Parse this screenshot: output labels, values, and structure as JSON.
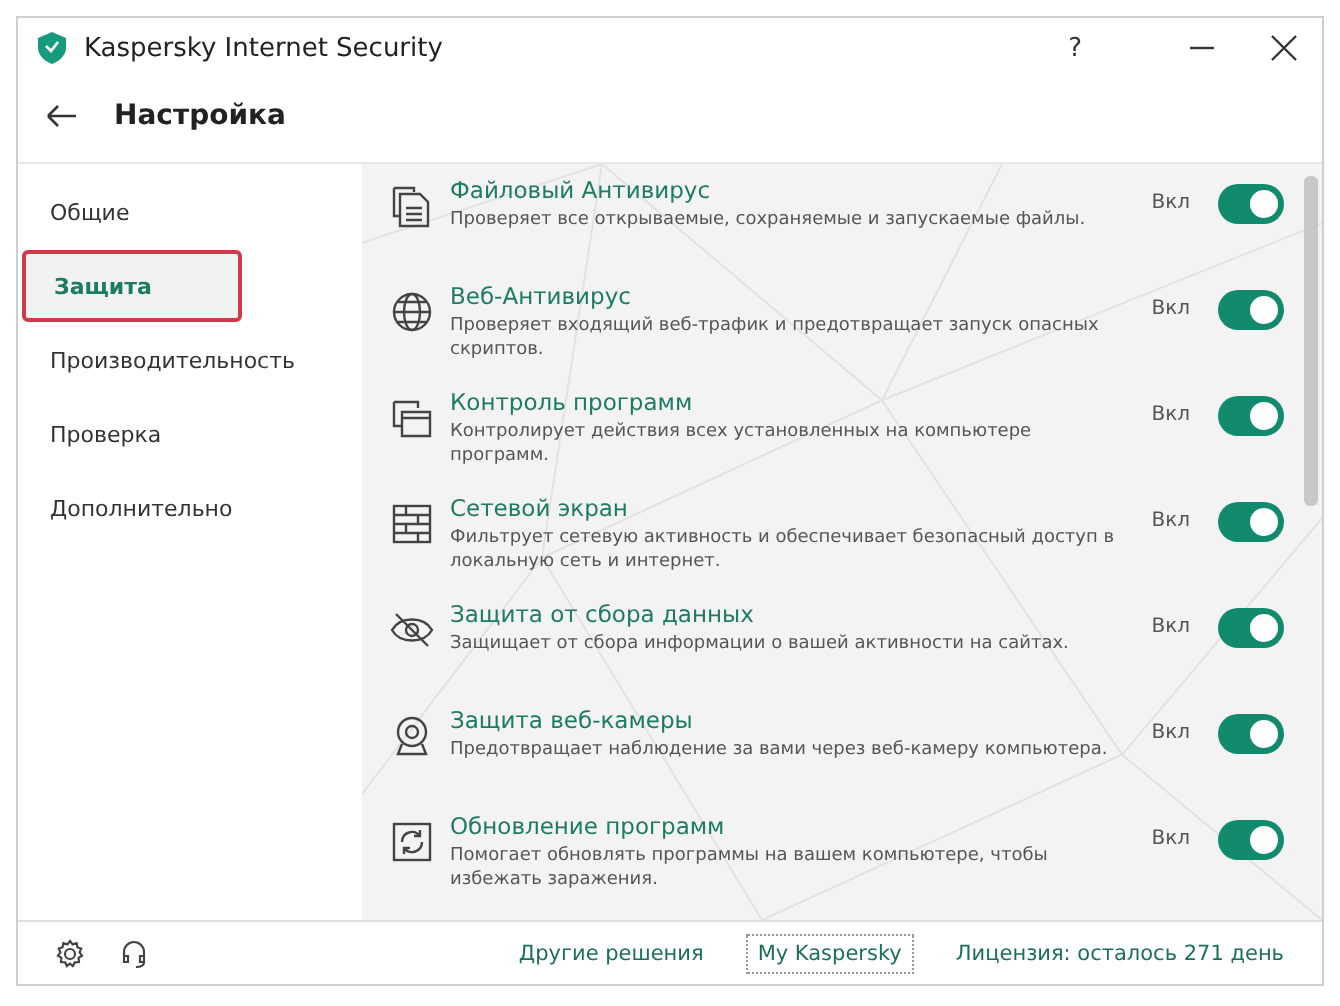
{
  "window": {
    "title": "Kaspersky Internet Security",
    "help": "?"
  },
  "header": {
    "title": "Настройка"
  },
  "sidebar": {
    "items": [
      {
        "label": "Общие",
        "selected": false
      },
      {
        "label": "Защита",
        "selected": true
      },
      {
        "label": "Производительность",
        "selected": false
      },
      {
        "label": "Проверка",
        "selected": false
      },
      {
        "label": "Дополнительно",
        "selected": false
      }
    ]
  },
  "components": [
    {
      "title": "Файловый Антивирус",
      "description": "Проверяет все открываемые, сохраняемые и запускаемые файлы.",
      "state_label": "Вкл",
      "on": true
    },
    {
      "title": "Веб-Антивирус",
      "description": "Проверяет входящий веб-трафик и предотвращает запуск опасных скриптов.",
      "state_label": "Вкл",
      "on": true
    },
    {
      "title": "Контроль программ",
      "description": "Контролирует действия всех установленных на компьютере программ.",
      "state_label": "Вкл",
      "on": true
    },
    {
      "title": "Сетевой экран",
      "description": "Фильтрует сетевую активность и обеспечивает безопасный доступ в локальную сеть и интернет.",
      "state_label": "Вкл",
      "on": true
    },
    {
      "title": "Защита от сбора данных",
      "description": "Защищает от сбора информации о вашей активности на сайтах.",
      "state_label": "Вкл",
      "on": true
    },
    {
      "title": "Защита веб-камеры",
      "description": "Предотвращает наблюдение за вами через веб-камеру компьютера.",
      "state_label": "Вкл",
      "on": true
    },
    {
      "title": "Обновление программ",
      "description": "Помогает обновлять программы на вашем компьютере, чтобы избежать заражения.",
      "state_label": "Вкл",
      "on": true
    }
  ],
  "footer": {
    "links": [
      "Другие решения",
      "My Kaspersky",
      "Лицензия: осталось 271 день"
    ]
  }
}
